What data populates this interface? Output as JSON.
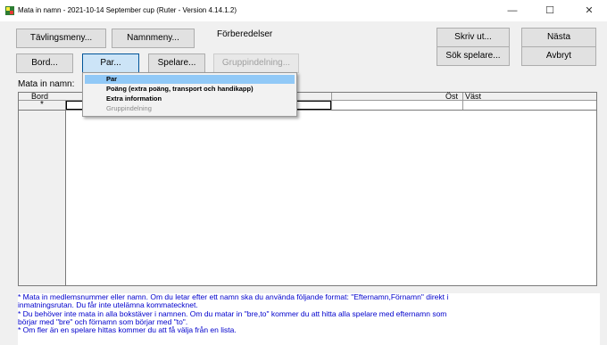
{
  "window": {
    "title": "Mata in namn - 2021-10-14 September cup  (Ruter - Version 4.14.1.2)",
    "minimize_glyph": "—",
    "maximize_glyph": "☐",
    "close_glyph": "✕"
  },
  "toolbar": {
    "tavlingsmeny": "Tävlingsmeny...",
    "namnmeny": "Namnmeny...",
    "section_label": "Förberedelser",
    "skriv_ut": "Skriv ut...",
    "nasta": "Nästa",
    "bord": "Bord...",
    "par": "Par...",
    "spelare": "Spelare...",
    "gruppindelning": "Gruppindelning...",
    "sok_spelare": "Sök spelare...",
    "avbryt": "Avbryt"
  },
  "input_label": "Mata in namn:",
  "grid": {
    "columns": [
      "Bord",
      "Öst",
      "Väst"
    ],
    "first_row_marker": "*"
  },
  "popup_menu": {
    "items": [
      {
        "label": "Par",
        "state": "highlighted"
      },
      {
        "label": "Poäng (extra poäng, transport och handikapp)",
        "state": "normal"
      },
      {
        "label": "Extra information",
        "state": "normal"
      },
      {
        "label": "Gruppindelning",
        "state": "disabled"
      }
    ]
  },
  "help": {
    "lines": [
      "* Mata in medlemsnummer eller namn. Om du letar efter ett namn ska du använda följande format: \"Efternamn,Förnamn\" direkt i",
      "inmatningsrutan. Du får inte utelämna kommatecknet.",
      "* Du behöver inte mata in alla bokstäver i namnen. Om du matar in \"bre,to\" kommer du att hitta alla spelare med efternamn som",
      "börjar med \"bre\" och förnamn som börjar med \"to\".",
      "* Om fler än en spelare hittas kommer du att få välja från en lista."
    ]
  },
  "colors": {
    "help_text": "#0000cc",
    "menu_highlight": "#91c9f7",
    "client_bg": "#f0f0f0"
  }
}
